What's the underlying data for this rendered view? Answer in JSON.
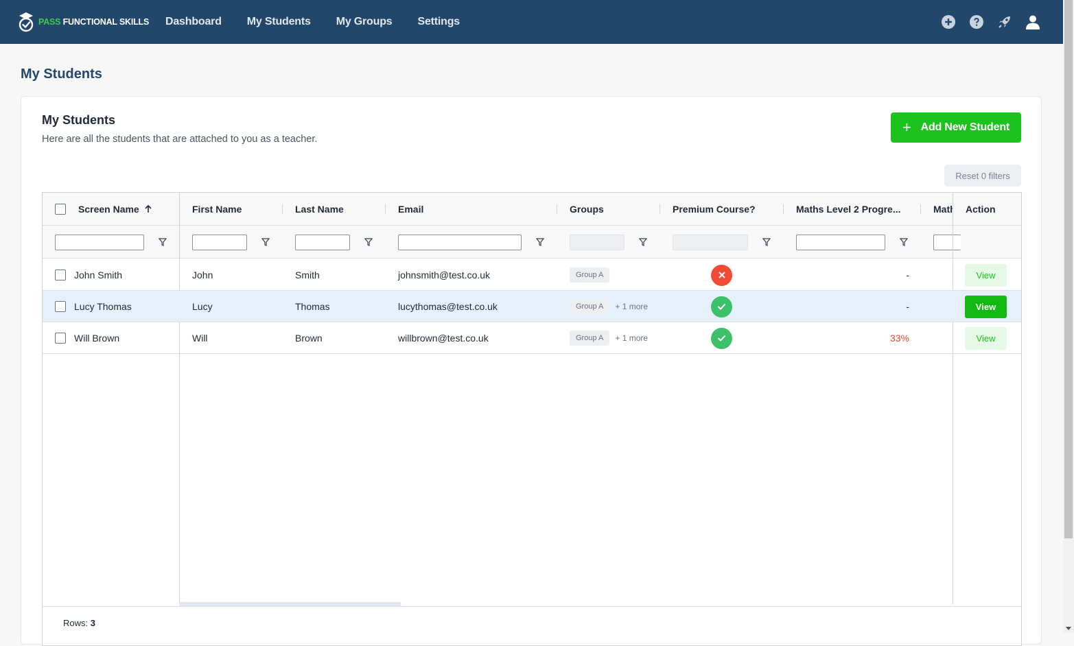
{
  "brand": {
    "name_part1": "PASS",
    "name_part2": "FUNCTIONAL SKILLS",
    "accent": "#3ccb4d",
    "nav_bg": "#23476b"
  },
  "nav": {
    "items": [
      "Dashboard",
      "My Students",
      "My Groups",
      "Settings"
    ],
    "icons": [
      "plus-circle-icon",
      "help-circle-icon",
      "rocket-icon",
      "user-icon"
    ]
  },
  "page": {
    "title": "My Students"
  },
  "card": {
    "title": "My Students",
    "subtitle": "Here are all the students that are attached to you as a teacher.",
    "add_button": "Add New Student",
    "reset_button": "Reset 0 filters"
  },
  "table": {
    "columns": [
      "Screen Name",
      "First Name",
      "Last Name",
      "Email",
      "Groups",
      "Premium Course?",
      "Maths Level 2 Progre...",
      "Math",
      "Action"
    ],
    "sort": {
      "column": "Screen Name",
      "direction": "ascending"
    },
    "rows": [
      {
        "screen_name": "John Smith",
        "first_name": "John",
        "last_name": "Smith",
        "email": "johnsmith@test.co.uk",
        "group": "Group A",
        "more": "",
        "premium": false,
        "progress": "-",
        "action": "View",
        "selected": false
      },
      {
        "screen_name": "Lucy Thomas",
        "first_name": "Lucy",
        "last_name": "Thomas",
        "email": "lucythomas@test.co.uk",
        "group": "Group A",
        "more": "+ 1 more",
        "premium": true,
        "progress": "-",
        "action": "View",
        "selected": true
      },
      {
        "screen_name": "Will Brown",
        "first_name": "Will",
        "last_name": "Brown",
        "email": "willbrown@test.co.uk",
        "group": "Group A",
        "more": "+ 1 more",
        "premium": true,
        "progress": "33%",
        "action": "View",
        "selected": false
      }
    ],
    "rows_label": "Rows:",
    "rows_count": "3"
  },
  "colors": {
    "success": "#1ec21e",
    "danger": "#f14b35",
    "check": "#3dc06c"
  }
}
